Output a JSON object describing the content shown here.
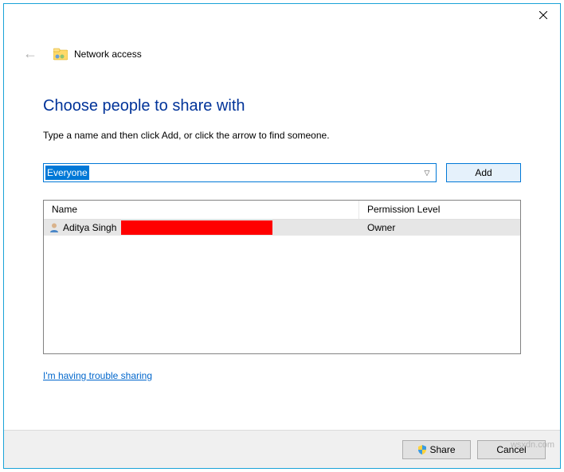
{
  "header": {
    "title": "Network access"
  },
  "main": {
    "heading": "Choose people to share with",
    "instruction": "Type a name and then click Add, or click the arrow to find someone.",
    "input_value": "Everyone",
    "add_label": "Add"
  },
  "table": {
    "col_name": "Name",
    "col_permission": "Permission Level",
    "rows": [
      {
        "name": "Aditya Singh",
        "permission": "Owner"
      }
    ]
  },
  "trouble_link": "I'm having trouble sharing",
  "footer": {
    "share_label": "Share",
    "cancel_label": "Cancel"
  },
  "watermark": "wsxdn.com"
}
